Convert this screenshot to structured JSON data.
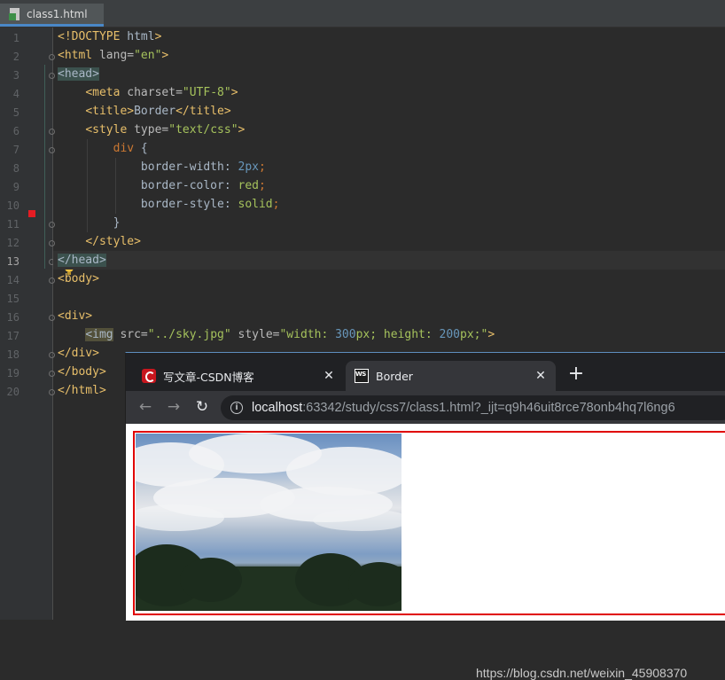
{
  "ide": {
    "file_tab": "class1.html",
    "code_lines": [
      {
        "n": "1",
        "segs": [
          [
            "tg",
            "<!DOCTYPE "
          ],
          [
            "tx",
            "html"
          ],
          [
            "tg",
            ">"
          ]
        ]
      },
      {
        "n": "2",
        "segs": [
          [
            "tg",
            "<html "
          ],
          [
            "at",
            "lang="
          ],
          [
            "st",
            "\"en\""
          ],
          [
            "tg",
            ">"
          ]
        ]
      },
      {
        "n": "3",
        "segs": [
          [
            "hl",
            "<head>"
          ]
        ]
      },
      {
        "n": "4",
        "segs": [
          [
            "tx",
            "    "
          ],
          [
            "tg",
            "<meta "
          ],
          [
            "at",
            "charset="
          ],
          [
            "st",
            "\"UTF-8\""
          ],
          [
            "tg",
            ">"
          ]
        ]
      },
      {
        "n": "5",
        "segs": [
          [
            "tx",
            "    "
          ],
          [
            "tg",
            "<title>"
          ],
          [
            "tx",
            "Border"
          ],
          [
            "tg",
            "</title>"
          ]
        ]
      },
      {
        "n": "6",
        "segs": [
          [
            "tx",
            "    "
          ],
          [
            "tg",
            "<style "
          ],
          [
            "at",
            "type="
          ],
          [
            "st",
            "\"text/css\""
          ],
          [
            "tg",
            ">"
          ]
        ]
      },
      {
        "n": "7",
        "segs": [
          [
            "tx",
            "        "
          ],
          [
            "kw",
            "div"
          ],
          [
            "tx",
            " {"
          ]
        ]
      },
      {
        "n": "8",
        "segs": [
          [
            "tx",
            "            border-width: "
          ],
          [
            "nu",
            "2px"
          ],
          [
            "kw",
            ";"
          ]
        ]
      },
      {
        "n": "9",
        "segs": [
          [
            "tx",
            "            border-color: "
          ],
          [
            "st",
            "red"
          ],
          [
            "kw",
            ";"
          ]
        ]
      },
      {
        "n": "10",
        "segs": [
          [
            "tx",
            "            border-style: "
          ],
          [
            "st",
            "solid"
          ],
          [
            "kw",
            ";"
          ]
        ]
      },
      {
        "n": "11",
        "segs": [
          [
            "tx",
            "        }"
          ]
        ]
      },
      {
        "n": "12",
        "segs": [
          [
            "tx",
            "    "
          ],
          [
            "tg",
            "</style>"
          ]
        ]
      },
      {
        "n": "13",
        "segs": [
          [
            "hl",
            "</head>"
          ]
        ]
      },
      {
        "n": "14",
        "segs": [
          [
            "tg",
            "<body>"
          ]
        ]
      },
      {
        "n": "15",
        "segs": []
      },
      {
        "n": "16",
        "segs": [
          [
            "tg",
            "<div>"
          ]
        ]
      },
      {
        "n": "17",
        "segs": [
          [
            "tx",
            "    "
          ],
          [
            "hli",
            "<img"
          ],
          [
            "tg",
            " "
          ],
          [
            "at",
            "src="
          ],
          [
            "st",
            "\"../sky.jpg\""
          ],
          [
            "tg",
            " "
          ],
          [
            "at",
            "style="
          ],
          [
            "st",
            "\"width: "
          ],
          [
            "nu",
            "300"
          ],
          [
            "st",
            "px; height: "
          ],
          [
            "nu",
            "200"
          ],
          [
            "st",
            "px;\""
          ],
          [
            "tg",
            ">"
          ]
        ]
      },
      {
        "n": "18",
        "segs": [
          [
            "tg",
            "</div>"
          ]
        ]
      },
      {
        "n": "19",
        "segs": [
          [
            "tg",
            "</body>"
          ]
        ]
      },
      {
        "n": "20",
        "segs": [
          [
            "tg",
            "</html>"
          ]
        ]
      }
    ],
    "current_line": "13"
  },
  "browser": {
    "tabs": [
      {
        "title": "写文章-CSDN博客",
        "favicon": "csdn-icon",
        "active": false
      },
      {
        "title": "Border",
        "favicon": "webstorm-icon",
        "active": true
      }
    ],
    "new_tab": "+",
    "close_glyph": "✕",
    "back_glyph": "←",
    "forward_glyph": "→",
    "reload_glyph": "↻",
    "info_glyph": "i",
    "url_host": "localhost",
    "url_rest": ":63342/study/css7/class1.html?_ijt=q9h46uit8rce78onb4hq7l6ng6",
    "border_color": "#e00000"
  },
  "watermark": "https://blog.csdn.net/weixin_45908370"
}
